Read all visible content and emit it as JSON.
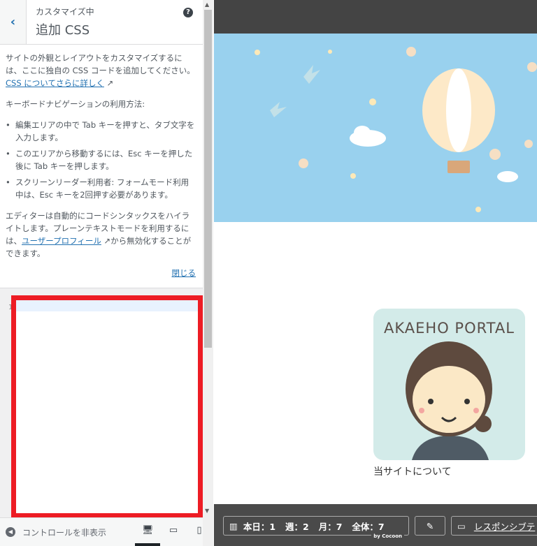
{
  "header": {
    "subtitle": "カスタマイズ中",
    "title": "追加 CSS",
    "help": "?",
    "back": "‹"
  },
  "description": {
    "intro": "サイトの外観とレイアウトをカスタマイズするには、ここに独自の CSS コードを追加してください。",
    "intro_link": "CSS についてさらに詳しく",
    "kbd_heading": "キーボードナビゲーションの利用方法:",
    "bullets": [
      "編集エリアの中で Tab キーを押すと、タブ文字を入力します。",
      "このエリアから移動するには、Esc キーを押した後に Tab キーを押します。",
      "スクリーンリーダー利用者: フォームモード利用中は、Esc キーを2回押す必要があります。"
    ],
    "editor_note": "エディターは自動的にコードシンタックスをハイライトします。プレーンテキストモードを利用するには、",
    "profile_link": "ユーザープロフィール",
    "editor_note_end": "から無効化することができます。",
    "close": "閉じる"
  },
  "editor": {
    "line_number": "1",
    "value": ""
  },
  "footer": {
    "collapse": "コントロールを非表示",
    "devices": [
      "desktop",
      "tablet",
      "mobile"
    ],
    "selected_device": "desktop"
  },
  "preview": {
    "brand": "AKAEHO PORTAL",
    "about": "当サイトについて",
    "stats": {
      "today": "本日：1",
      "week": "週：2",
      "month": "月：7",
      "total": "全体：7",
      "by": "by Cocoon"
    },
    "responsive": "レスポンシブテ"
  },
  "colors": {
    "sky": "#99d1ee",
    "highlight": "#ed1c24",
    "link": "#2271b1"
  }
}
